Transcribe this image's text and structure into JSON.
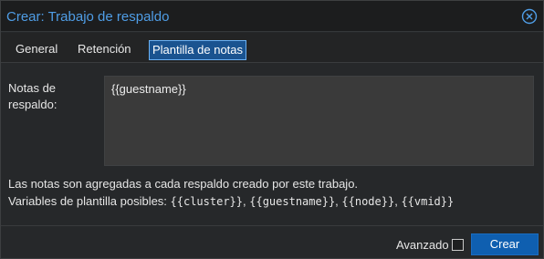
{
  "window": {
    "title": "Crear: Trabajo de respaldo",
    "accent_color": "#4f9de6"
  },
  "tabs": [
    {
      "label": "General",
      "active": false
    },
    {
      "label": "Retención",
      "active": false
    },
    {
      "label": "Plantilla de notas",
      "active": true
    }
  ],
  "notes": {
    "label": "Notas de respaldo:",
    "value": "{{guestname}}"
  },
  "info": {
    "line1": "Las notas son agregadas a cada respaldo creado por este trabajo.",
    "line2_prefix": "Variables de plantilla posibles: ",
    "variables": [
      "{{cluster}}",
      "{{guestname}}",
      "{{node}}",
      "{{vmid}}"
    ]
  },
  "footer": {
    "advanced_label": "Avanzado",
    "advanced_checked": false,
    "create_label": "Crear"
  },
  "icons": {
    "close": "close-circle-icon"
  }
}
